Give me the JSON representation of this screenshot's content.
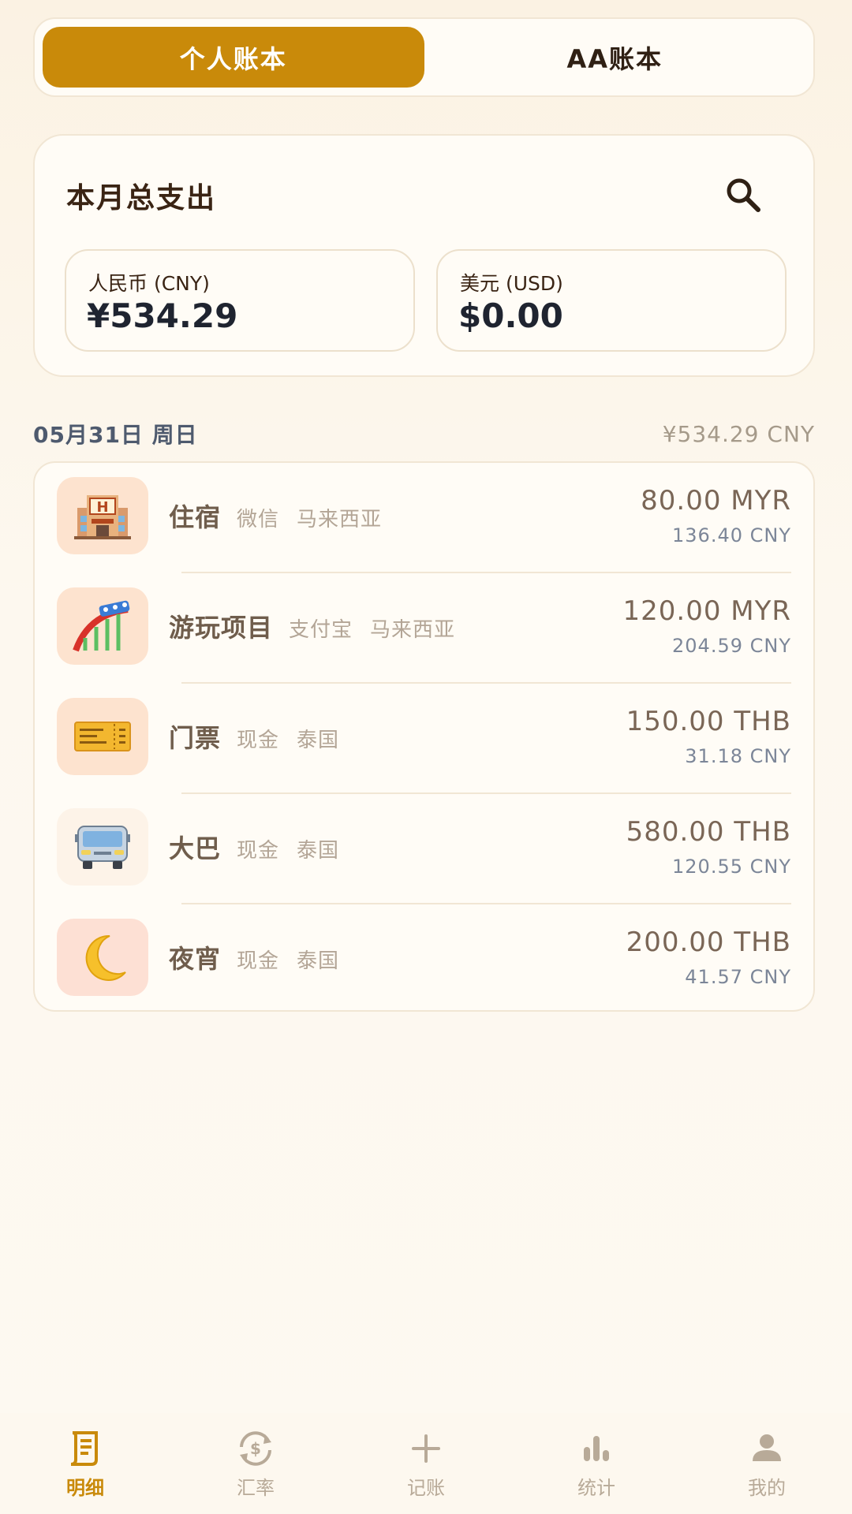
{
  "tabs": [
    {
      "label": "个人账本",
      "active": true
    },
    {
      "label": "AA账本",
      "active": false
    }
  ],
  "summary": {
    "title": "本月总支出",
    "cny": {
      "label": "人民币 (CNY)",
      "value": "¥534.29"
    },
    "usd": {
      "label": "美元 (USD)",
      "value": "$0.00"
    }
  },
  "day": {
    "date": "05月31日 周日",
    "total": "¥534.29 CNY"
  },
  "transactions": [
    {
      "icon": "hotel-icon",
      "name": "住宿",
      "payment": "微信",
      "country": "马来西亚",
      "amount": "80.00 MYR",
      "converted": "136.40 CNY",
      "icon_bg": "#fde3cf"
    },
    {
      "icon": "roller-coaster-icon",
      "name": "游玩项目",
      "payment": "支付宝",
      "country": "马来西亚",
      "amount": "120.00 MYR",
      "converted": "204.59 CNY",
      "icon_bg": "#fde3cf"
    },
    {
      "icon": "ticket-icon",
      "name": "门票",
      "payment": "现金",
      "country": "泰国",
      "amount": "150.00 THB",
      "converted": "31.18 CNY",
      "icon_bg": "#fde3cf"
    },
    {
      "icon": "bus-icon",
      "name": "大巴",
      "payment": "现金",
      "country": "泰国",
      "amount": "580.00 THB",
      "converted": "120.55 CNY",
      "icon_bg": "#fdf3e8"
    },
    {
      "icon": "moon-icon",
      "name": "夜宵",
      "payment": "现金",
      "country": "泰国",
      "amount": "200.00 THB",
      "converted": "41.57 CNY",
      "icon_bg": "#fde0d4"
    }
  ],
  "nav": [
    {
      "label": "明细",
      "icon": "ledger-icon",
      "active": true
    },
    {
      "label": "汇率",
      "icon": "exchange-icon",
      "active": false
    },
    {
      "label": "记账",
      "icon": "plus-icon",
      "active": false
    },
    {
      "label": "统计",
      "icon": "chart-icon",
      "active": false
    },
    {
      "label": "我的",
      "icon": "user-icon",
      "active": false
    }
  ],
  "colors": {
    "accent": "#c98a0a",
    "background": "#fbf2e3",
    "card": "#fffcf6"
  }
}
